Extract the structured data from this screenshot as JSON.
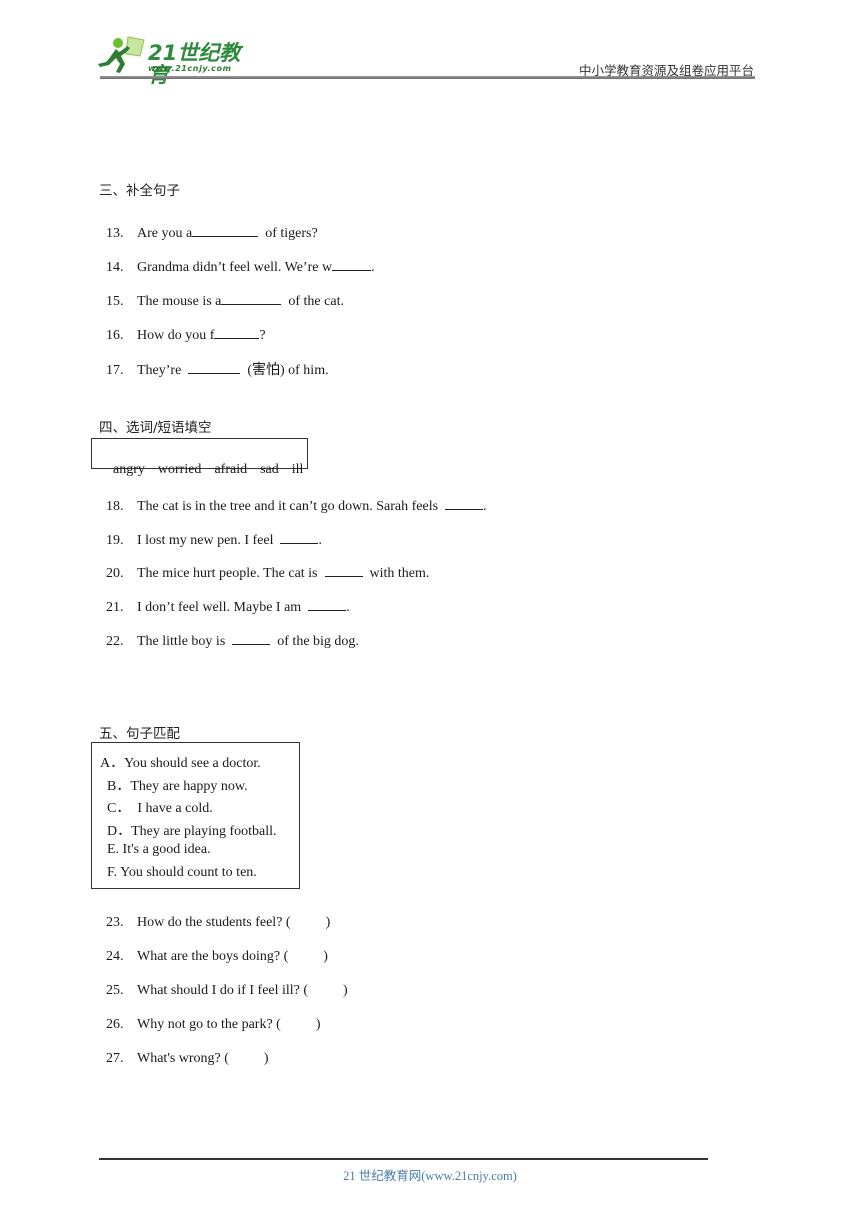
{
  "header": {
    "logo_brand": "21世纪教育",
    "logo_url": "www.21cnjy.com",
    "slogan": "中小学教育资源及组卷应用平台"
  },
  "sections": [
    {
      "title": "三、补全句子",
      "questions": [
        {
          "num": "13.",
          "before": "Are you a",
          "after": "  of tigers?"
        },
        {
          "num": "14.",
          "before": "Grandma didn’t feel well. We’re w",
          "after": "."
        },
        {
          "num": "15.",
          "before": "The mouse is a",
          "after": "  of the cat."
        },
        {
          "num": "16.",
          "before": "How do you f",
          "after": "?"
        },
        {
          "num": "17.",
          "before": "They’re  ",
          "after": "  (害怕) of him."
        }
      ]
    },
    {
      "title": "四、选词/短语填空",
      "word_bank": [
        "angry",
        "worried",
        "afraid",
        "sad",
        "ill"
      ],
      "questions": [
        {
          "num": "18.",
          "before": "The cat is in the tree and it can’t go down. Sarah feels  ",
          "after": "."
        },
        {
          "num": "19.",
          "before": "I lost my new pen. I feel  ",
          "after": "."
        },
        {
          "num": "20.",
          "before": "The mice hurt people. The cat is  ",
          "after": "  with them."
        },
        {
          "num": "21.",
          "before": "I don’t feel well. Maybe I am  ",
          "after": "."
        },
        {
          "num": "22.",
          "before": "The little boy is  ",
          "after": "  of the big dog."
        }
      ]
    },
    {
      "title": "五、句子匹配",
      "options": [
        "A．You should see a doctor.",
        "B．They are happy now.",
        "C．  I have a cold.",
        "D．They are playing football.",
        "E. It's a good idea.",
        "F. You should count to ten."
      ],
      "questions": [
        {
          "num": "23.",
          "text": "How do the students feel? (          )"
        },
        {
          "num": "24.",
          "text": "What are the boys doing? (          )"
        },
        {
          "num": "25.",
          "text": "What should I do if I feel ill? (          )"
        },
        {
          "num": "26.",
          "text": "Why not go to the park? (          )"
        },
        {
          "num": "27.",
          "text": "What's wrong? (          )"
        }
      ]
    }
  ],
  "footer": {
    "text": "21 世纪教育网(www.21cnjy.com)"
  }
}
